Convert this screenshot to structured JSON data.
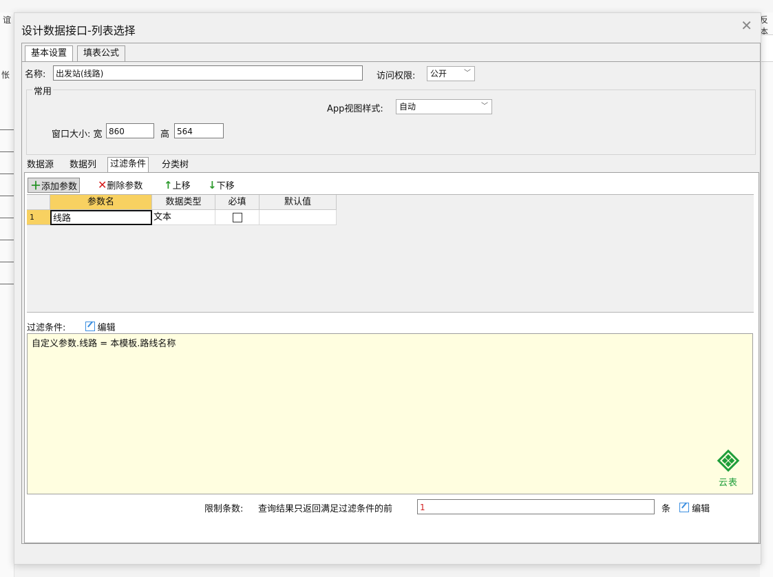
{
  "background": {
    "right_glyph": "反本",
    "left_glyph": "怅",
    "top_left_glyph": "谊"
  },
  "dialog": {
    "title": "设计数据接口-列表选择",
    "close_icon": "close-icon",
    "tabs": [
      {
        "label": "基本设置",
        "active": true
      },
      {
        "label": "填表公式",
        "active": false
      }
    ],
    "name_label": "名称:",
    "name_value": "出发站(线路)",
    "access_label": "访问权限:",
    "access_value": "公开",
    "group_title": "常用",
    "app_view_label": "App视图样式:",
    "app_view_value": "自动",
    "window_size_label": "窗口大小: 宽",
    "width_value": "860",
    "height_label": "高",
    "height_value": "564",
    "inner_tabs": [
      {
        "label": "数据源",
        "active": false
      },
      {
        "label": "数据列",
        "active": false
      },
      {
        "label": "过滤条件",
        "active": true
      },
      {
        "label": "分类树",
        "active": false
      }
    ],
    "toolbar": {
      "add_label": "添加参数",
      "delete_label": "删除参数",
      "up_label": "上移",
      "down_label": "下移"
    },
    "grid": {
      "columns": [
        "参数名",
        "数据类型",
        "必填",
        "默认值"
      ],
      "rows": [
        {
          "index": "1",
          "name": "线路",
          "type": "文本",
          "required": false,
          "default": ""
        }
      ]
    },
    "filter_label": "过滤条件:",
    "filter_edit_label": "编辑",
    "filter_expression": "自定义参数.线路 = 本模板.路线名称",
    "logo_text": "云表",
    "limit_label": "限制条数:",
    "limit_desc": "查询结果只返回满足过滤条件的前",
    "limit_value": "1",
    "limit_unit": "条",
    "limit_edit_label": "编辑"
  }
}
